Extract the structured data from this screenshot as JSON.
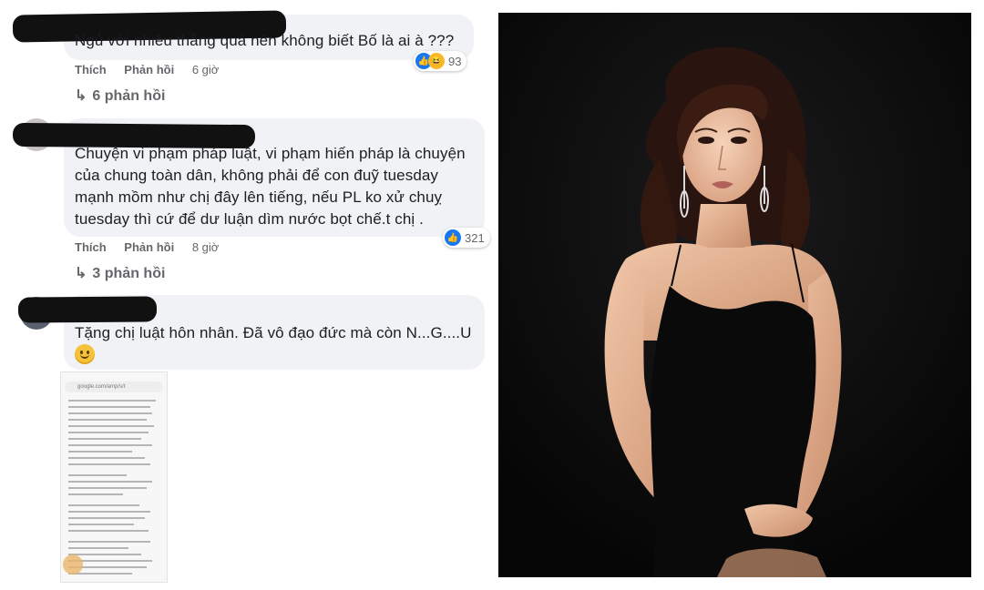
{
  "comments": [
    {
      "text_lines": [
        "Ngủ với nhiều thằng quá nên không biết Bố là ai à ???"
      ],
      "like_label": "Thích",
      "reply_label": "Phản hồi",
      "time": "6 giờ",
      "reaction_count": "93",
      "replies_label": "6 phản hồi"
    },
    {
      "text_lines": [
        "Chuyện vi phạm pháp luật, vi phạm hiến pháp là chuyện",
        "của chung toàn dân, không phải để con đuỹ tuesday",
        "mạnh mồm như chị đây lên tiếng, nếu PL ko xử chuỵ",
        "tuesday thì cứ để dư luận dìm nước bọt chế.t chị ."
      ],
      "like_label": "Thích",
      "reply_label": "Phản hồi",
      "time": "8 giờ",
      "reaction_count": "321",
      "replies_label": "3 phản hồi"
    },
    {
      "text_lines": [
        "Tặng chị luật hôn nhân. Đã vô đạo đức mà còn N...G....U"
      ],
      "emoji": "smiling-face"
    }
  ],
  "attachment": {
    "url_bar": "google.com/amp/s/t"
  },
  "colors": {
    "bubble": "#f0f2f5",
    "meta_text": "#65676b",
    "like_blue": "#1877f2",
    "photo_bg": "#0c0c0d",
    "dress": "#0a0a0a"
  }
}
